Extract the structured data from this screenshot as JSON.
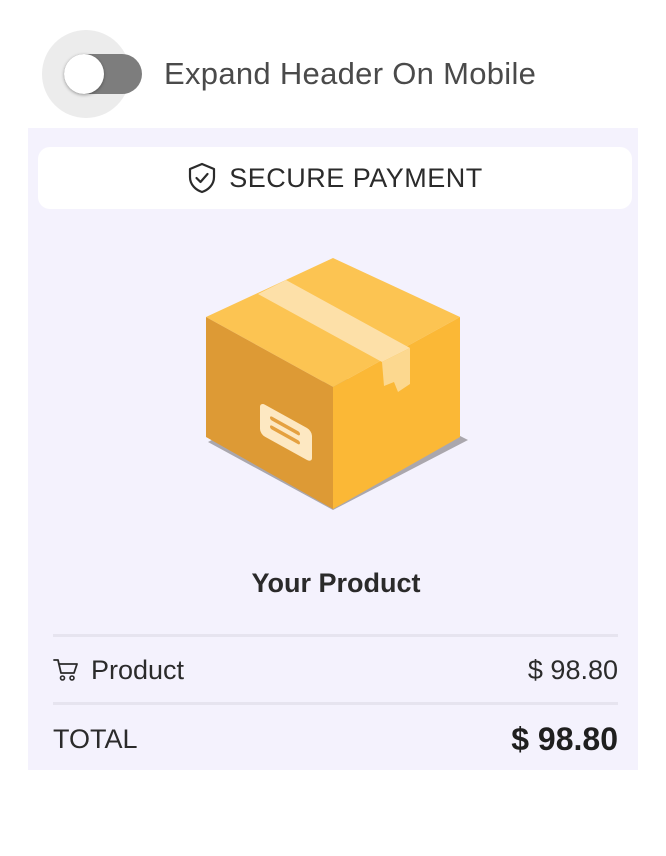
{
  "toggle": {
    "label": "Expand Header On Mobile",
    "state": "off"
  },
  "card": {
    "secure_label": "SECURE PAYMENT",
    "secure_icon": "shield-check-icon",
    "product_image": "cardboard-box-icon",
    "product_title": "Your Product",
    "line_item": {
      "icon": "cart-icon",
      "label": "Product",
      "price": "$ 98.80"
    },
    "total": {
      "label": "TOTAL",
      "price": "$ 98.80"
    }
  },
  "colors": {
    "card_background": "#f4f2fd",
    "box_front": "#eda63a",
    "box_side": "#fbb836",
    "box_tape": "#fde0a8",
    "toggle_track": "#7d7d7d"
  }
}
